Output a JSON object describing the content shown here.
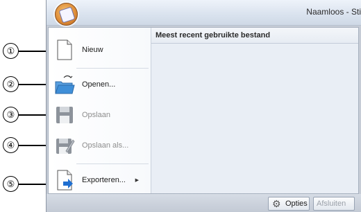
{
  "window": {
    "title": "Naamloos - Sti"
  },
  "recent_files": {
    "header": "Meest recent gebruikte bestand"
  },
  "menu_items": [
    {
      "label": "Nieuw",
      "icon": "new-document-icon",
      "enabled": true
    },
    {
      "label": "Openen...",
      "icon": "open-folder-icon",
      "enabled": true
    },
    {
      "label": "Opslaan",
      "icon": "save-disk-icon",
      "enabled": false
    },
    {
      "label": "Opslaan als...",
      "icon": "save-as-icon",
      "enabled": false
    },
    {
      "label": "Exporteren...",
      "icon": "export-icon",
      "enabled": true,
      "submenu_arrow": "▶"
    }
  ],
  "callouts": [
    "①",
    "②",
    "③",
    "④",
    "⑤"
  ],
  "footer": {
    "options_label": "Opties",
    "exit_label": "Afsluiten"
  },
  "colors": {
    "window_bg": "#c6ccd6",
    "recent_pane": "#e9eef5",
    "folder": "#3f8fd8",
    "disk": "#8d939b"
  }
}
